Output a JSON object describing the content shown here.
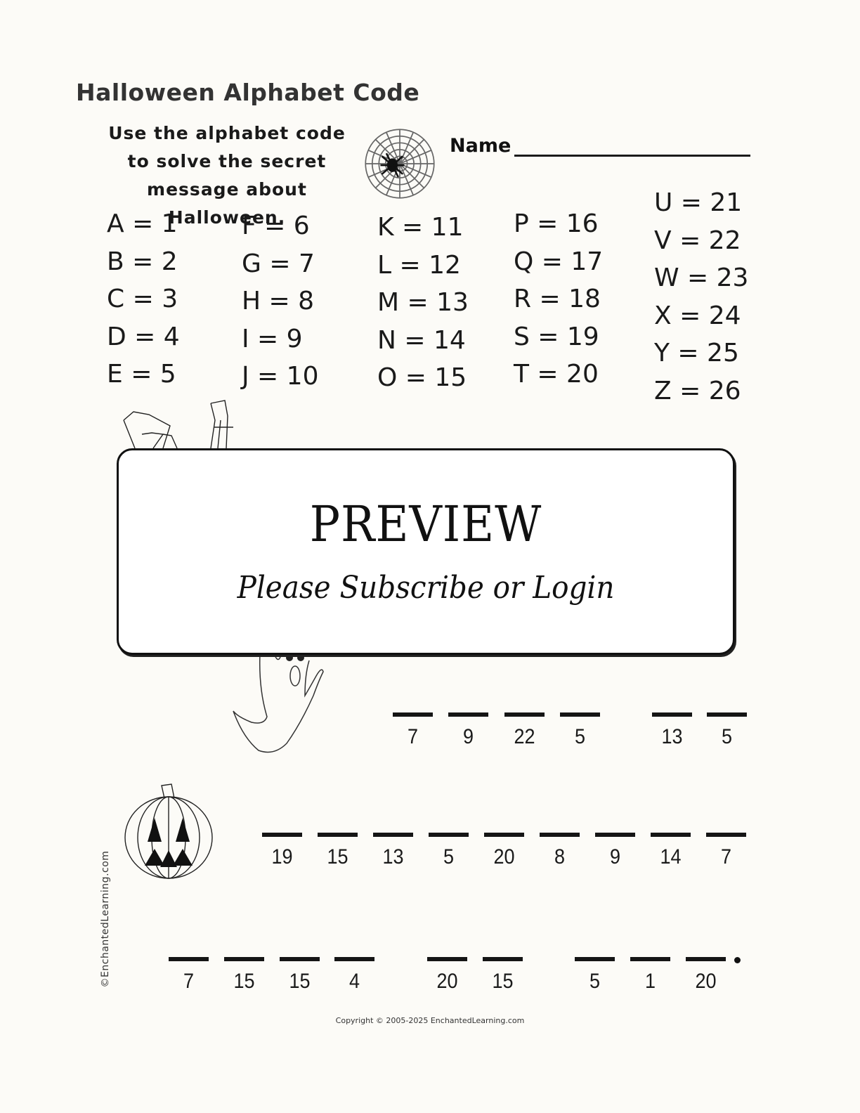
{
  "title": "Halloween Alphabet Code",
  "instructions": "Use the alphabet code to solve the secret message about Halloween.",
  "name_label": "Name",
  "code_columns": [
    [
      "A = 1",
      "B = 2",
      "C = 3",
      "D = 4",
      "E = 5"
    ],
    [
      "F = 6",
      "G = 7",
      "H = 8",
      "I = 9",
      "J = 10"
    ],
    [
      "K = 11",
      "L = 12",
      "M = 13",
      "N = 14",
      "O = 15"
    ],
    [
      "P = 16",
      "Q = 17",
      "R = 18",
      "S = 19",
      "T = 20"
    ],
    [
      "U = 21",
      "V = 22",
      "W = 23",
      "X = 24",
      "Y = 25",
      "Z = 26"
    ]
  ],
  "preview": {
    "title": "PREVIEW",
    "subtitle": "Please Subscribe or Login"
  },
  "puzzle_rows": [
    {
      "words": [
        [
          "7",
          "9",
          "22",
          "5"
        ],
        [
          "13",
          "5"
        ]
      ]
    },
    {
      "words": [
        [
          "19",
          "15",
          "13",
          "5",
          "20",
          "8",
          "9",
          "14",
          "7"
        ]
      ]
    },
    {
      "words": [
        [
          "7",
          "15",
          "15",
          "4"
        ],
        [
          "20",
          "15"
        ],
        [
          "5",
          "1",
          "20"
        ]
      ],
      "ends_with_period": true
    }
  ],
  "illustrations": [
    "spider-web",
    "bat",
    "ghost",
    "jack-o-lantern"
  ],
  "side_credit": "©EnchantedLearning.com",
  "copyright": "Copyright © 2005-2025 EnchantedLearning.com"
}
